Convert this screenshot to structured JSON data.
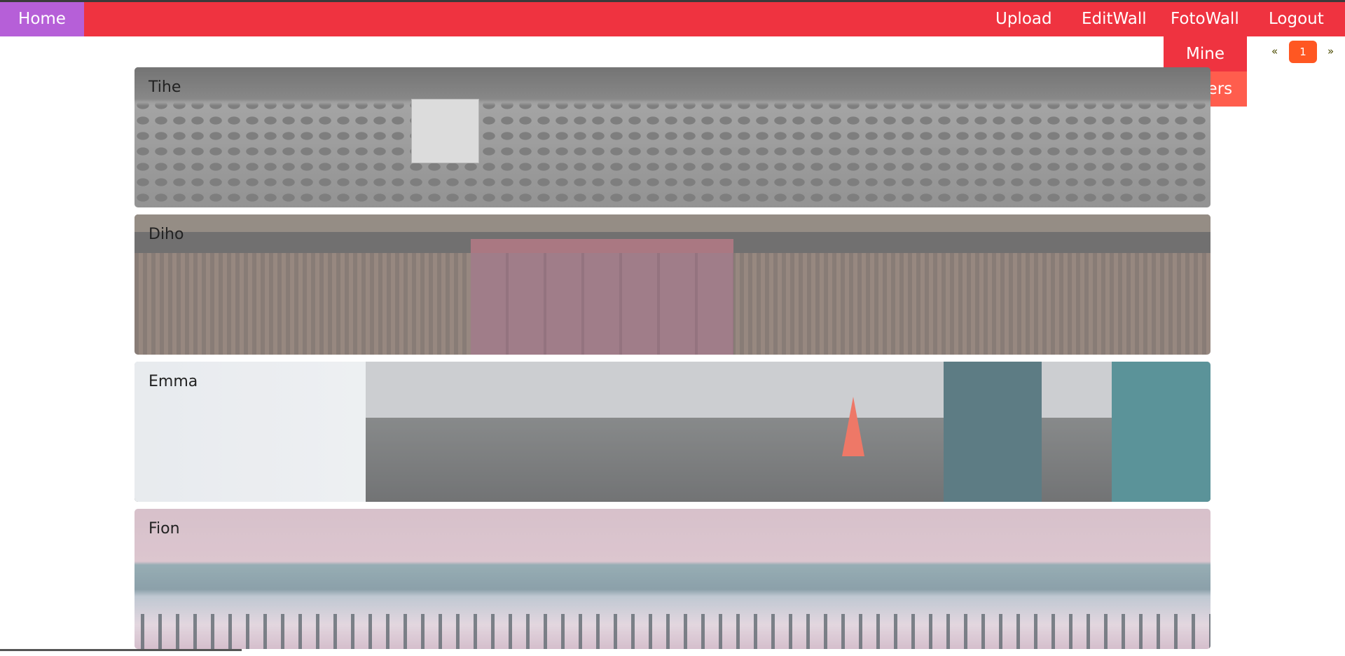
{
  "nav": {
    "home": "Home",
    "upload": "Upload",
    "editwall": "EditWall",
    "fotowall": "FotoWall",
    "logout": "Logout"
  },
  "dropdown": {
    "mine": "Mine",
    "others": "Others"
  },
  "pagination": {
    "prev": "«",
    "current": "1",
    "next": "»"
  },
  "wall": {
    "cards": [
      {
        "name": "Tihe"
      },
      {
        "name": "Diho"
      },
      {
        "name": "Emma"
      },
      {
        "name": "Fion"
      }
    ]
  },
  "colors": {
    "navbar": "#ef3340",
    "home": "#b65fd8",
    "dropdown_mine": "#ef3340",
    "dropdown_others": "#ff5d4d",
    "page_active": "#ff5722"
  }
}
